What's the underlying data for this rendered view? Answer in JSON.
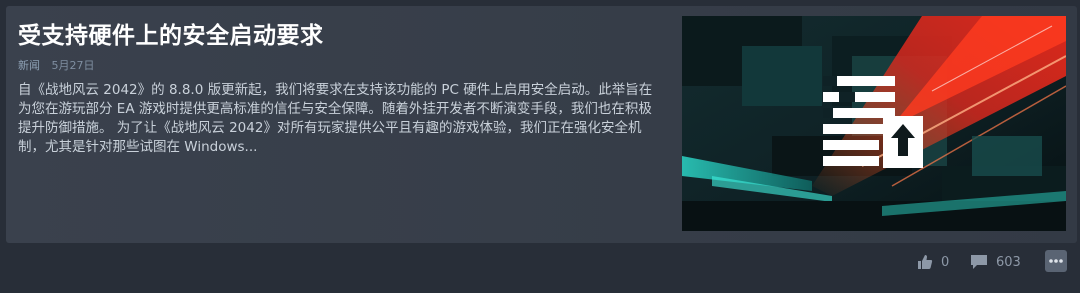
{
  "article": {
    "title": "受支持硬件上的安全启动要求",
    "category": "新闻",
    "date": "5月27日",
    "body": "自《战地风云 2042》的 8.8.0 版更新起，我们将要求在支持该功能的 PC 硬件上启用安全启动。此举旨在为您在游玩部分 EA 游戏时提供更高标准的信任与安全保障。随着外挂开发者不断演变手段，我们也在积极提升防御措施。 为了让《战地风云 2042》对所有玩家提供公平且有趣的游戏体验，我们正在强化安全机制，尤其是针对那些试图在 Windows..."
  },
  "thumbnail": {
    "icon": "secure-boot-upload-icon"
  },
  "footer": {
    "likes": "0",
    "comments": "603",
    "like_icon": "thumbs-up-icon",
    "comment_icon": "comment-icon",
    "more_icon": "more-icon"
  }
}
